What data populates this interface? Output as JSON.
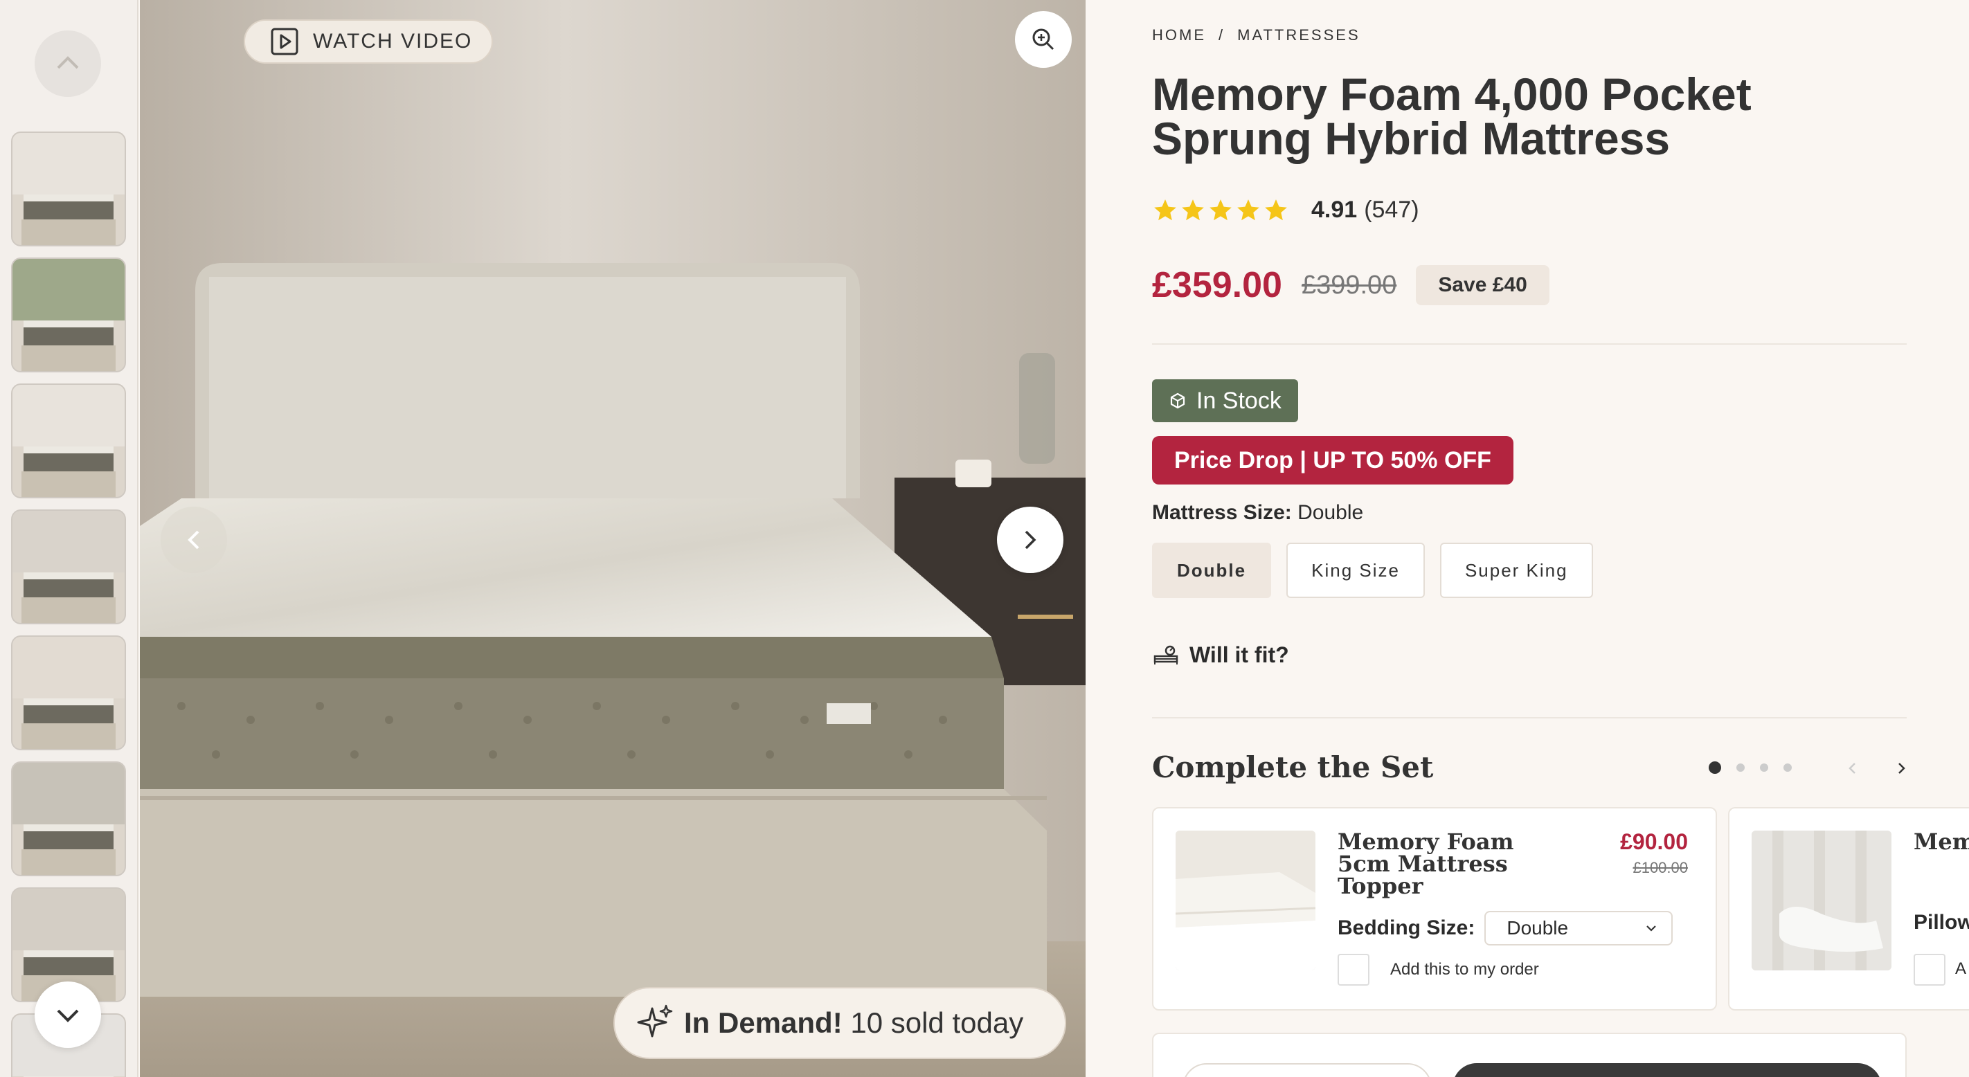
{
  "rail": {
    "thumbnails": [
      {
        "alt": "thumb-1",
        "wall": "#e8e3dc"
      },
      {
        "alt": "thumb-2",
        "wall": "#9ea88a"
      },
      {
        "alt": "thumb-3",
        "wall": "#e8e3dc"
      },
      {
        "alt": "thumb-4",
        "wall": "#d9d3cb"
      },
      {
        "alt": "thumb-5",
        "wall": "#e2dbd2"
      },
      {
        "alt": "thumb-6",
        "wall": "#c7c2b8"
      },
      {
        "alt": "thumb-7",
        "wall": "#d4cec5"
      },
      {
        "alt": "thumb-8",
        "wall": "#e5e2de"
      }
    ]
  },
  "hero": {
    "watch_video": "WATCH VIDEO",
    "demand_bold": "In Demand!",
    "demand_text": " 10 sold today"
  },
  "breadcrumb": {
    "home": "HOME",
    "sep": "/",
    "current": "MATTRESSES"
  },
  "product": {
    "title": "Memory Foam 4,000 Pocket Sprung Hybrid Mattress",
    "rating_value": "4.91",
    "rating_count": "(547)",
    "stars": 5,
    "price_now": "£359.00",
    "price_old": "£399.00",
    "save": "Save £40",
    "stock": "In Stock",
    "promo": "Price Drop | UP TO 50% OFF",
    "size_label": "Mattress Size:",
    "size_value": "Double",
    "sizes": [
      "Double",
      "King Size",
      "Super King"
    ],
    "fit": "Will it fit?"
  },
  "complete_set": {
    "title": "Complete the Set",
    "pages": 4,
    "active_page": 1,
    "cards": [
      {
        "name": "Memory Foam 5cm Mattress Topper",
        "price_now": "£90.00",
        "price_old": "£100.00",
        "bedding_label": "Bedding Size:",
        "bedding_value": "Double",
        "add_label": "Add this to my order"
      },
      {
        "name": "Memo Conto",
        "option_label": "Pillow",
        "add_label": "A"
      }
    ]
  },
  "colors": {
    "accent": "#b3243f",
    "stock_green": "#5e7056",
    "star": "#f5c518",
    "background": "#faf6f2"
  },
  "icons": [
    "chevron-up-icon",
    "chevron-down-icon",
    "play-icon",
    "zoom-icon",
    "chevron-left-icon",
    "chevron-right-icon",
    "sparkle-icon",
    "box-icon",
    "bed-measure-icon",
    "star-icon"
  ]
}
